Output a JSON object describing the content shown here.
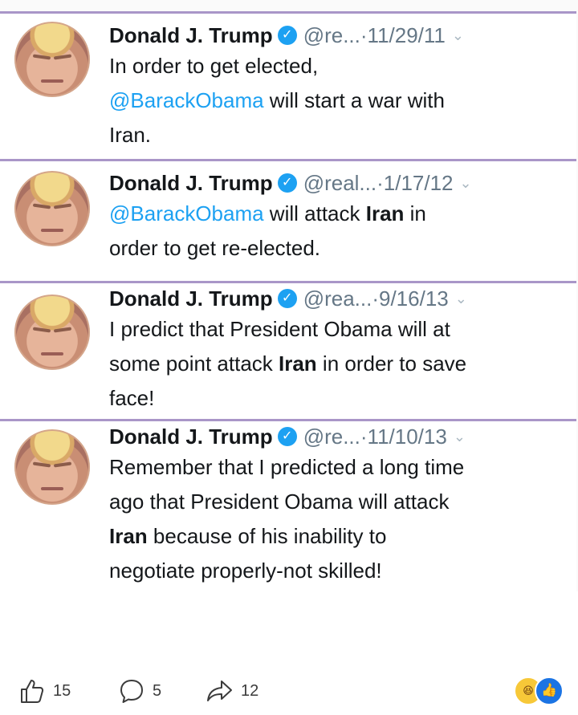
{
  "tweets": [
    {
      "name": "Donald J. Trump",
      "handle": "@re...",
      "date": "·11/29/11",
      "text": [
        {
          "t": "In order to get elected,",
          "s": "normal"
        },
        {
          "br": true
        },
        {
          "t": "@BarackObama",
          "s": "mention"
        },
        {
          "t": " will start a war with",
          "s": "normal"
        },
        {
          "br": true
        },
        {
          "t": "Iran.",
          "s": "normal"
        }
      ]
    },
    {
      "name": "Donald J. Trump",
      "handle": "@real...",
      "date": "·1/17/12",
      "text": [
        {
          "t": "@BarackObama",
          "s": "mention"
        },
        {
          "t": " will attack ",
          "s": "normal"
        },
        {
          "t": "Iran",
          "s": "bold"
        },
        {
          "t": " in",
          "s": "normal"
        },
        {
          "br": true
        },
        {
          "t": "order to get re-elected.",
          "s": "normal"
        }
      ]
    },
    {
      "name": "Donald J. Trump",
      "handle": "@rea...",
      "date": "·9/16/13",
      "text": [
        {
          "t": "I predict that President Obama will at",
          "s": "normal"
        },
        {
          "br": true
        },
        {
          "t": "some point attack ",
          "s": "normal"
        },
        {
          "t": "Iran",
          "s": "bold"
        },
        {
          "t": " in order to save",
          "s": "normal"
        },
        {
          "br": true
        },
        {
          "t": "face!",
          "s": "normal"
        }
      ]
    },
    {
      "name": "Donald J. Trump",
      "handle": "@re...",
      "date": "·11/10/13",
      "text": [
        {
          "t": "Remember that I predicted a long time",
          "s": "normal"
        },
        {
          "br": true
        },
        {
          "t": "ago that President Obama will attack",
          "s": "normal"
        },
        {
          "br": true
        },
        {
          "t": "Iran",
          "s": "bold"
        },
        {
          "t": " because of his inability to",
          "s": "normal"
        },
        {
          "br": true
        },
        {
          "t": "negotiate properly-not skilled!",
          "s": "normal"
        }
      ]
    }
  ],
  "actions": {
    "likes": "15",
    "comments": "5",
    "shares": "12"
  },
  "icons": {
    "verified": "verified-check-icon",
    "chevron": "chevron-down-icon",
    "like": "thumbs-up-icon",
    "comment": "comment-bubble-icon",
    "share": "share-arrow-icon",
    "reaction_haha": "haha-reaction-icon",
    "reaction_like": "like-reaction-icon"
  },
  "colors": {
    "mention": "#1da1f2",
    "divider": "#a996c8",
    "secondary_text": "#657786"
  }
}
